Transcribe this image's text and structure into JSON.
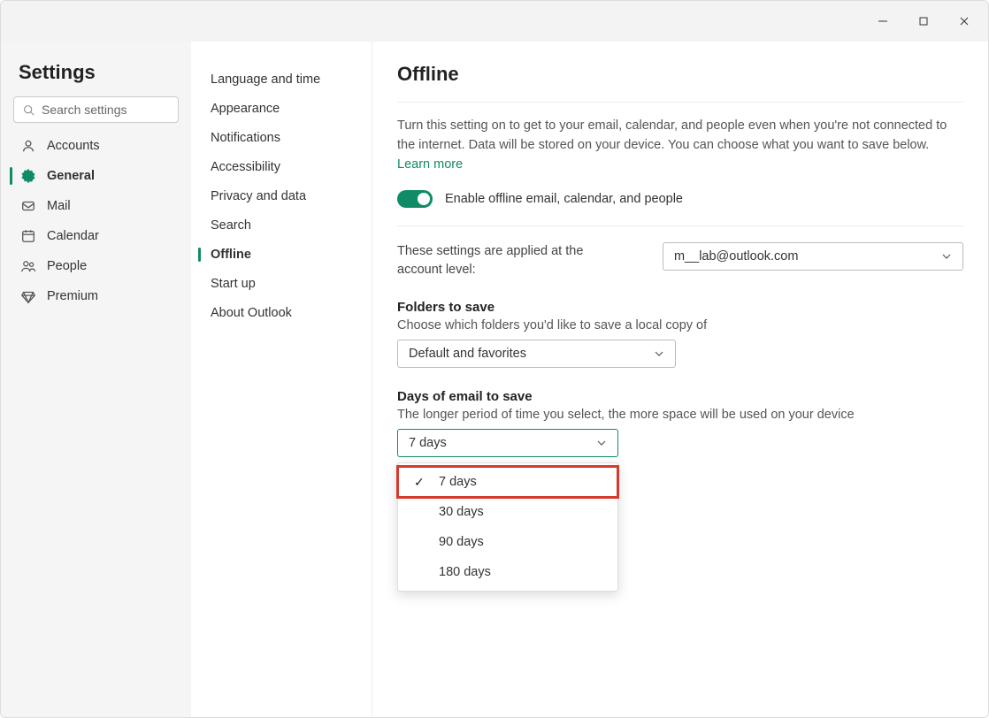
{
  "titlebar": {
    "min": "−",
    "max": "▢",
    "close": "✕"
  },
  "sidebar": {
    "title": "Settings",
    "search_placeholder": "Search settings",
    "items": [
      {
        "label": "Accounts"
      },
      {
        "label": "General"
      },
      {
        "label": "Mail"
      },
      {
        "label": "Calendar"
      },
      {
        "label": "People"
      },
      {
        "label": "Premium"
      }
    ]
  },
  "subnav": {
    "items": [
      {
        "label": "Language and time"
      },
      {
        "label": "Appearance"
      },
      {
        "label": "Notifications"
      },
      {
        "label": "Accessibility"
      },
      {
        "label": "Privacy and data"
      },
      {
        "label": "Search"
      },
      {
        "label": "Offline"
      },
      {
        "label": "Start up"
      },
      {
        "label": "About Outlook"
      }
    ]
  },
  "main": {
    "heading": "Offline",
    "desc_text": "Turn this setting on to get to your email, calendar, and people even when you're not connected to the internet. Data will be stored on your device. You can choose what you want to save below. ",
    "learn_more": "Learn more",
    "toggle_label": "Enable offline email, calendar, and people",
    "account_label": "These settings are applied at the account level:",
    "account_value": "m__lab@outlook.com",
    "folders_title": "Folders to save",
    "folders_desc": "Choose which folders you'd like to save a local copy of",
    "folders_value": "Default and favorites",
    "days_title": "Days of email to save",
    "days_desc": "The longer period of time you select, the more space will be used on your device",
    "days_value": "7 days",
    "days_options": [
      "7 days",
      "30 days",
      "90 days",
      "180 days"
    ]
  }
}
